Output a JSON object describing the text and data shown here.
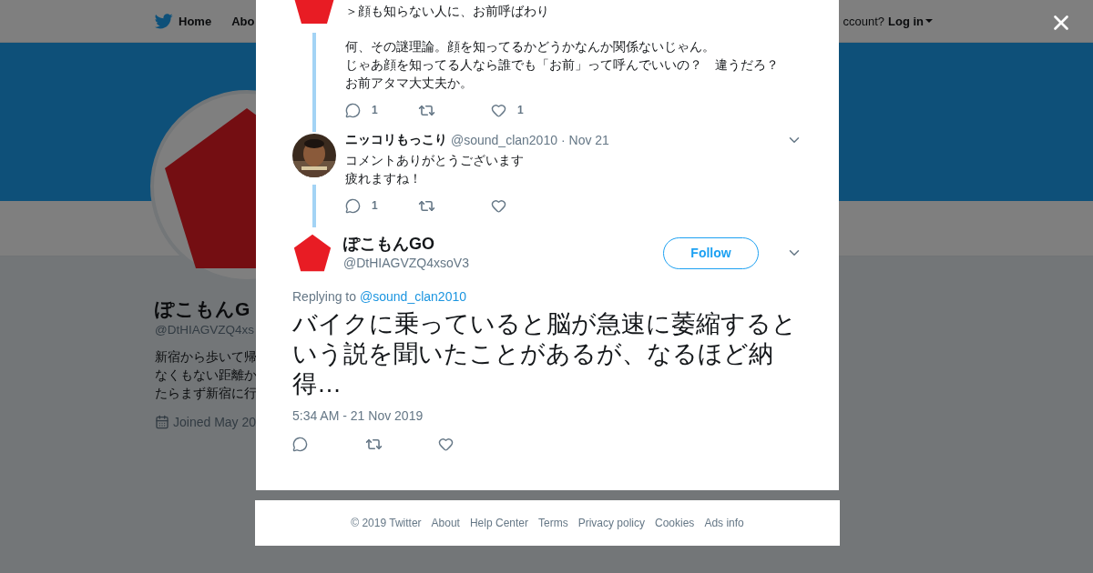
{
  "header": {
    "nav": [
      {
        "label": "Home"
      },
      {
        "label": "Abo"
      }
    ],
    "account_prompt": "ccount?",
    "login": "Log in"
  },
  "profile": {
    "name": "ぽこもんG",
    "handle": "@DtHIAGVZQ4xs",
    "bio": [
      "新宿から歩いて帰",
      "なくもない距離か",
      "たらまず新宿に行"
    ],
    "joined": "Joined May 20"
  },
  "thread": [
    {
      "avatar": {
        "kind": "pentagon"
      },
      "paragraphs": [
        [
          "＞顔も知らない人に、お前呼ばわり"
        ],
        [
          "何、その謎理論。顔を知ってるかどうかなんか関係ないじゃん。",
          "じゃあ顔を知ってる人なら誰でも「お前」って呼んでいいの？　違うだろ？",
          "お前アタマ大丈夫か。"
        ]
      ],
      "replies": "1",
      "likes": "1"
    },
    {
      "avatar": {
        "kind": "picture"
      },
      "name": "ニッコリもっこり",
      "handle": "@sound_clan2010",
      "date": "· Nov 21",
      "paragraphs": [
        [
          "コメントありがとうございます",
          "疲れますね！"
        ]
      ],
      "replies": "1"
    }
  ],
  "main_tweet": {
    "name": "ぽこもんGO",
    "handle": "@DtHIAGVZQ4xsoV3",
    "follow": "Follow",
    "replying_label": "Replying to",
    "replying_to": "@sound_clan2010",
    "text": "バイクに乗っていると脳が急速に萎縮するという説を聞いたことがあるが、なるほど納得…",
    "timestamp": "5:34 AM - 21 Nov 2019"
  },
  "footer": [
    "© 2019 Twitter",
    "About",
    "Help Center",
    "Terms",
    "Privacy policy",
    "Cookies",
    "Ads info"
  ]
}
